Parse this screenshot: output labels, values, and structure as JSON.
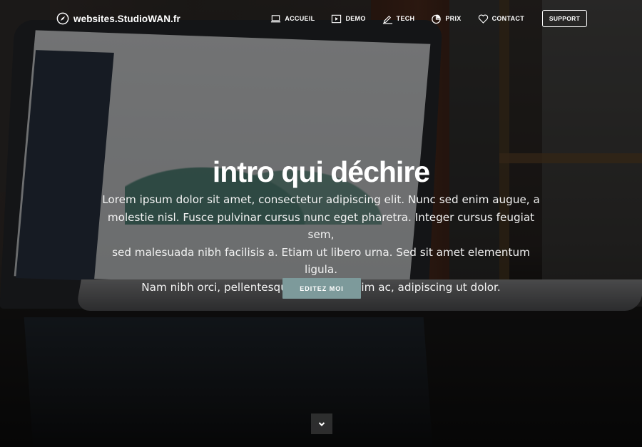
{
  "nav": {
    "brand": "websites.StudioWAN.fr",
    "brand_icon": "compass-icon",
    "items": [
      {
        "label": "ACCUEIL",
        "icon": "laptop-icon"
      },
      {
        "label": "DEMO",
        "icon": "play-icon"
      },
      {
        "label": "TECH",
        "icon": "pencil-ruler-icon"
      },
      {
        "label": "PRIX",
        "icon": "pie-chart-icon"
      },
      {
        "label": "CONTACT",
        "icon": "heart-icon"
      }
    ],
    "support_label": "SUPPORT"
  },
  "hero": {
    "title": "intro qui déchire",
    "lines": [
      "Lorem ipsum dolor sit amet, consectetur adipiscing elit. Nunc sed enim augue, a",
      "molestie nisl. Fusce pulvinar cursus nunc eget pharetra. Integer cursus feugiat sem,",
      "sed malesuada nibh facilisis a. Etiam ut libero urna. Sed sit amet elementum ligula.",
      "Nam nibh orci, pellentesque quis dignissim ac, adipiscing ut dolor."
    ],
    "cta_label": "EDITEZ MOI",
    "scroll_icon": "chevron-down-icon"
  },
  "colors": {
    "accent": "#7d9a9b",
    "overlay": "#000000",
    "text": "#ffffff"
  }
}
